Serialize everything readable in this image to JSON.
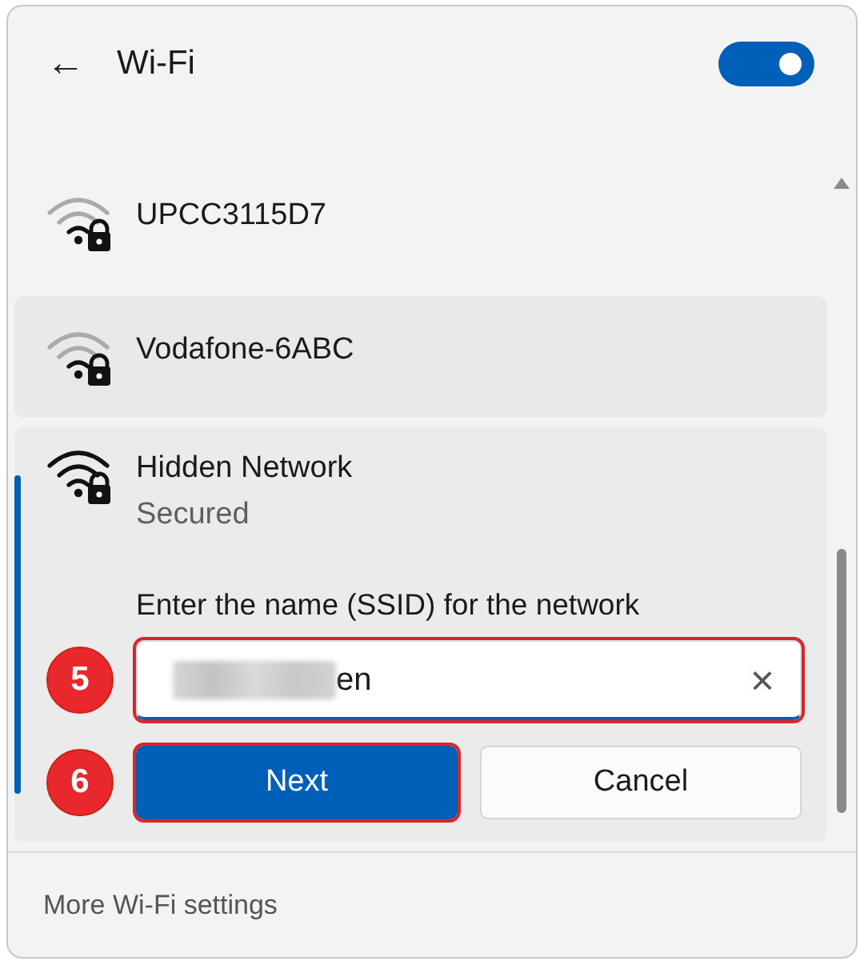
{
  "header": {
    "back": "←",
    "title": "Wi-Fi",
    "toggle": {
      "on": true
    }
  },
  "networks": [
    {
      "name": "UPCC3115D7",
      "secured": true,
      "hovered": false,
      "expanded": false
    },
    {
      "name": "Vodafone-6ABC",
      "secured": true,
      "hovered": true,
      "expanded": false
    },
    {
      "name": "Hidden Network",
      "status": "Secured",
      "secured": true,
      "hovered": false,
      "expanded": true,
      "prompt": "Enter the name (SSID) for the network",
      "ssid_field": {
        "value": "en",
        "redacted": true,
        "clear": "×",
        "annotation": "5"
      },
      "buttons": [
        {
          "label": "Next",
          "kind": "primary",
          "annotation": "6"
        },
        {
          "label": "Cancel",
          "kind": "secondary"
        }
      ]
    }
  ],
  "footer": {
    "link": "More Wi-Fi settings"
  }
}
